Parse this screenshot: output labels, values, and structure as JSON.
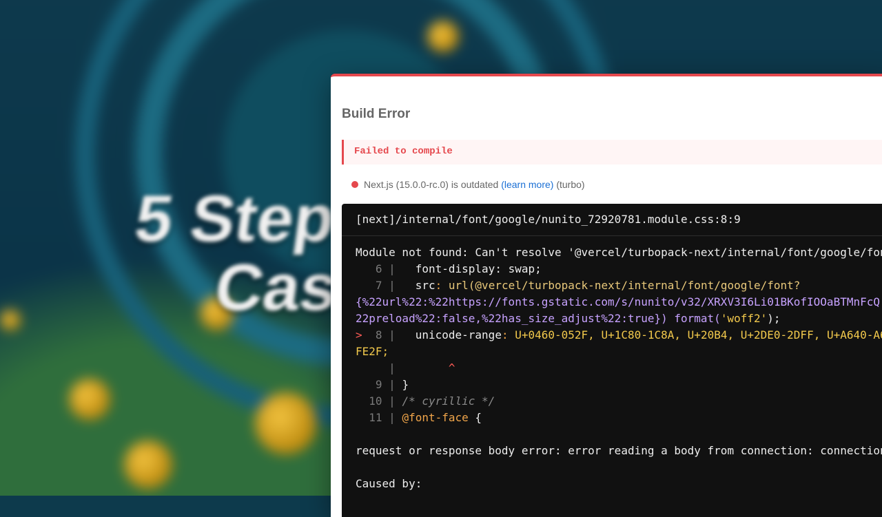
{
  "background": {
    "title_line1": "5 Step",
    "title_line2": "Cas"
  },
  "overlay": {
    "title": "Build Error",
    "failed_message": "Failed to compile",
    "version": {
      "text": "Next.js (15.0.0-rc.0) is outdated",
      "link": "(learn more)",
      "suffix": "(turbo)",
      "status_color": "#e5484d"
    },
    "code_header": "[next]/internal/font/google/nunito_72920781.module.css:8:9",
    "lines": {
      "l1": "Module not found: Can't resolve '@vercel/turbopack-next/internal/font/google/font",
      "n6": "6",
      "l6": "font-display: swap;",
      "n7": "7",
      "l7a_prop": "src",
      "l7a_rest": "url(@vercel/turbopack-next/internal/font/google/font?",
      "l7b": "{%22url%22:%22https://fonts.gstatic.com/s/nunito/v32/XRXV3I6Li01BKofIOOaBTMnFcQ",
      "l7c_a": "22preload%22:false,%22has_size_adjust%22:true}) format(",
      "l7c_str": "'woff2'",
      "l7c_b": ");",
      "marker": ">",
      "n8": "8",
      "l8a_prop": "unicode-range",
      "l8a_rest": "U+0460-052F, U+1C80-1C8A, U+20B4, U+2DE0-2DFF, U+A640-A6",
      "l8b": "FE2F;",
      "caret": "^",
      "n9": "9",
      "l9": "}",
      "n10": "10",
      "l10": "/* cyrillic */",
      "n11": "11",
      "l11_kw": "@font-face",
      "l11_rest": " {",
      "req": "request or response body error: error reading a body from connection: connection",
      "caused": "Caused by:"
    }
  }
}
